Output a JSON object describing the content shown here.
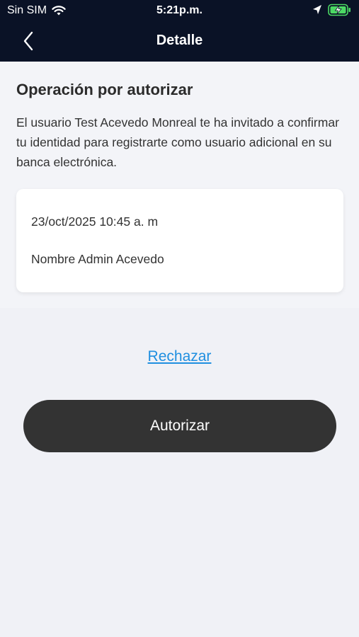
{
  "status_bar": {
    "carrier": "Sin SIM",
    "time": "5:21p.m.",
    "icons": [
      "wifi-icon",
      "location-arrow-icon",
      "battery-charging-icon"
    ]
  },
  "nav": {
    "title": "Detalle",
    "back_icon": "chevron-left-icon"
  },
  "operation": {
    "heading": "Operación por autorizar",
    "description": "El usuario Test Acevedo Monreal te ha invitado a confirmar tu identidad para registrarte como usuario adicional en su banca electrónica.",
    "date": "23/oct/2025 10:45 a. m",
    "name": "Nombre Admin Acevedo"
  },
  "actions": {
    "reject_label": "Rechazar",
    "authorize_label": "Autorizar"
  },
  "colors": {
    "header_bg": "#0a1226",
    "link": "#1f8fe0",
    "primary_button": "#333333",
    "battery": "#4cd964",
    "page_bg": "#f0f1f6"
  }
}
